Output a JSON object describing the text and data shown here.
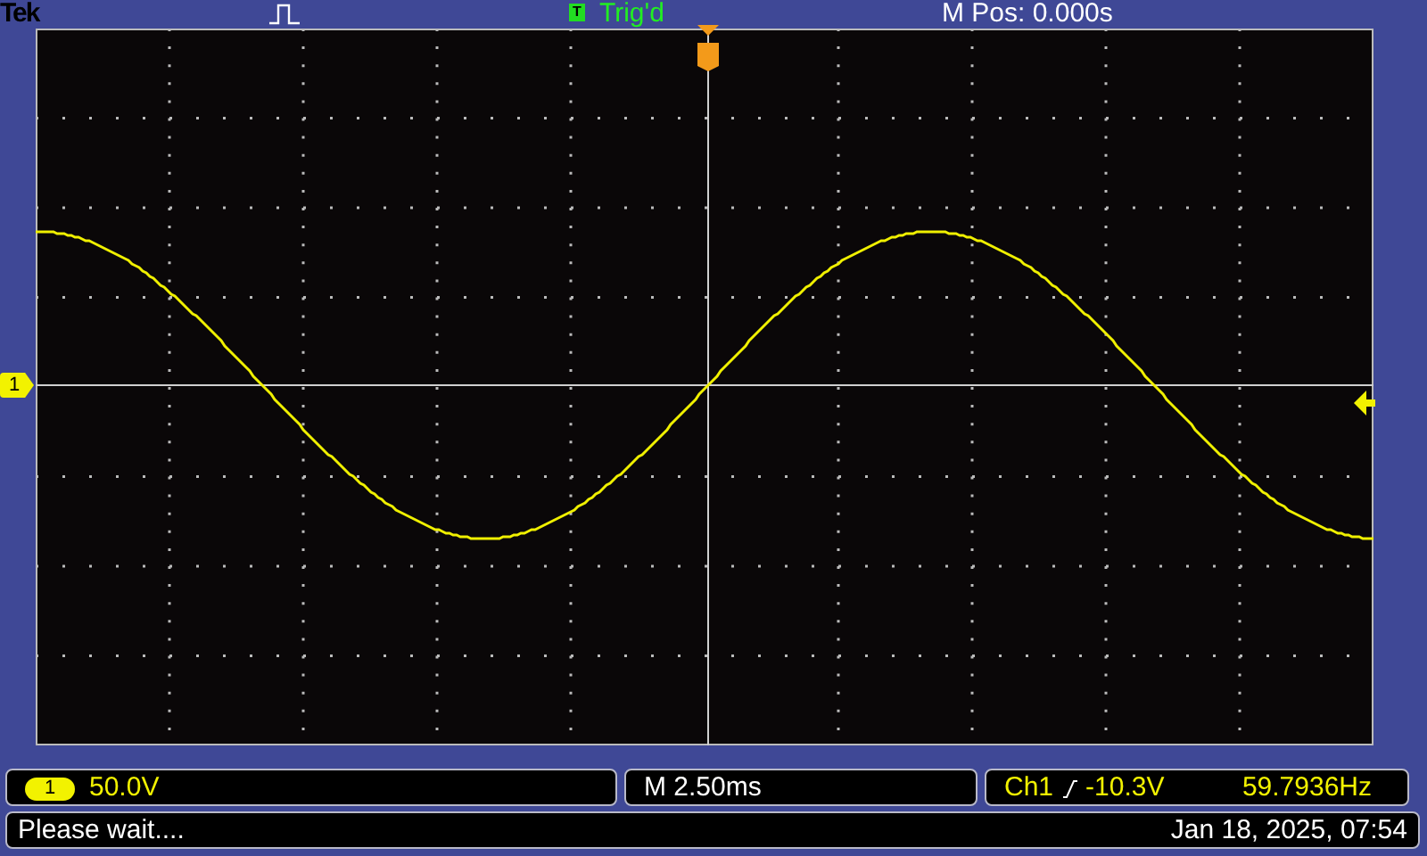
{
  "header": {
    "brand": "Tek",
    "trigger_icon": "T",
    "trigger_state": "Trig'd",
    "position": "M Pos: 0.000s"
  },
  "channel_marker": "1",
  "status": {
    "channel": "1",
    "volts_div": "50.0V",
    "timebase": "M 2.50ms",
    "trigger_source": "Ch1",
    "trigger_level": "-10.3V",
    "frequency": "59.7936Hz"
  },
  "footer": {
    "message": "Please wait....",
    "datetime": "Jan 18, 2025, 07:54"
  }
}
